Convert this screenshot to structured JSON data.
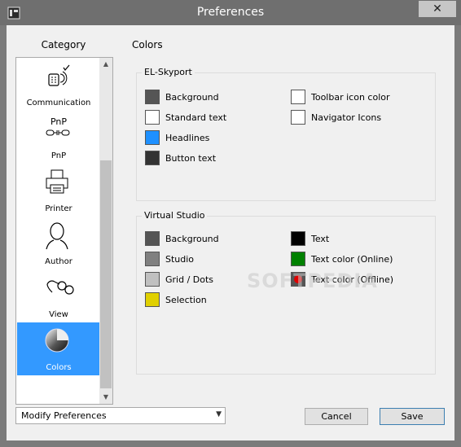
{
  "window": {
    "title": "Preferences",
    "close_symbol": "✕",
    "app_icon": "app-icon"
  },
  "sidebar": {
    "header": "Category",
    "items": [
      {
        "label": "Communication",
        "icon": "communication-icon",
        "selected": false
      },
      {
        "label": "PnP",
        "icon": "pnp-icon",
        "selected": false
      },
      {
        "label": "Printer",
        "icon": "printer-icon",
        "selected": false
      },
      {
        "label": "Author",
        "icon": "author-icon",
        "selected": false
      },
      {
        "label": "View",
        "icon": "view-icon",
        "selected": false
      },
      {
        "label": "Colors",
        "icon": "colors-icon",
        "selected": true
      }
    ],
    "pnp_icon_text": "PnP",
    "scroll_up": "▲",
    "scroll_down": "▼"
  },
  "main": {
    "section_title": "Colors",
    "skyport": {
      "title": "EL-Skyport",
      "items": [
        {
          "label": "Background",
          "color": "#555555"
        },
        {
          "label": "Standard text",
          "color": "#ffffff"
        },
        {
          "label": "Headlines",
          "color": "#1e90ff"
        },
        {
          "label": "Button text",
          "color": "#333333"
        },
        {
          "label": "Toolbar icon color",
          "color": "#ffffff"
        },
        {
          "label": "Navigator Icons",
          "color": "#ffffff"
        }
      ]
    },
    "studio": {
      "title": "Virtual Studio",
      "items": [
        {
          "label": "Background",
          "color": "#555555"
        },
        {
          "label": "Studio",
          "color": "#808080"
        },
        {
          "label": "Grid / Dots",
          "color": "#c0c0c0"
        },
        {
          "label": "Selection",
          "color": "#e0d000"
        },
        {
          "label": "Text",
          "color": "#000000"
        },
        {
          "label": "Text color (Online)",
          "color": "#008000"
        },
        {
          "label": "Text color (Offline)",
          "color": "#555555"
        }
      ]
    }
  },
  "watermark": "SOFTPEDIA",
  "footer": {
    "select_value": "Modify Preferences",
    "select_arrow": "▼",
    "cancel_label": "Cancel",
    "save_label": "Save"
  }
}
